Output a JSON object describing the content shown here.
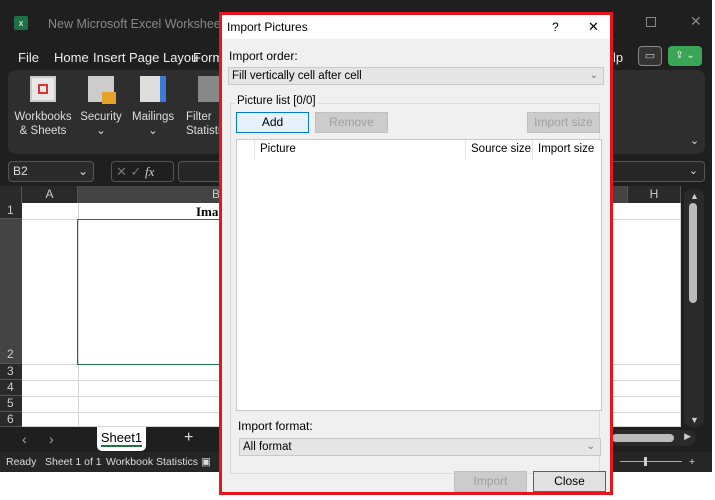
{
  "excel": {
    "title": "New Microsoft Excel Worksheet.xlsx",
    "menu_tabs": [
      "File",
      "Home",
      "Insert",
      "Page Layou",
      "Form",
      "lp"
    ],
    "ribbon": [
      {
        "label": "Workbooks\n& Sheets",
        "icon": "workbook-icon"
      },
      {
        "label": "Security",
        "icon": "lock-icon"
      },
      {
        "label": "Mailings",
        "icon": "mail-icon"
      },
      {
        "label": "Filter\nStatisti",
        "icon": "filter-icon"
      }
    ],
    "name_box": "B2",
    "columns": [
      "A",
      "B",
      "H"
    ],
    "rows": [
      "1",
      "2",
      "3",
      "4",
      "5",
      "6"
    ],
    "cell_b1": "Ima",
    "sheet_tab": "Sheet1",
    "status": {
      "ready": "Ready",
      "sheet": "Sheet 1 of 1",
      "stats": "Workbook Statistics"
    }
  },
  "dialog": {
    "title": "Import Pictures",
    "help": "?",
    "close_x": "✕",
    "import_order_label": "Import order:",
    "import_order_value": "Fill vertically cell after cell",
    "picture_list_label": "Picture list [0/0]",
    "add": "Add",
    "remove": "Remove",
    "import_size_btn": "Import size",
    "list_headers": [
      "Picture",
      "Source size",
      "Import size"
    ],
    "import_format_label": "Import format:",
    "import_format_value": "All format",
    "import": "Import",
    "close": "Close"
  }
}
